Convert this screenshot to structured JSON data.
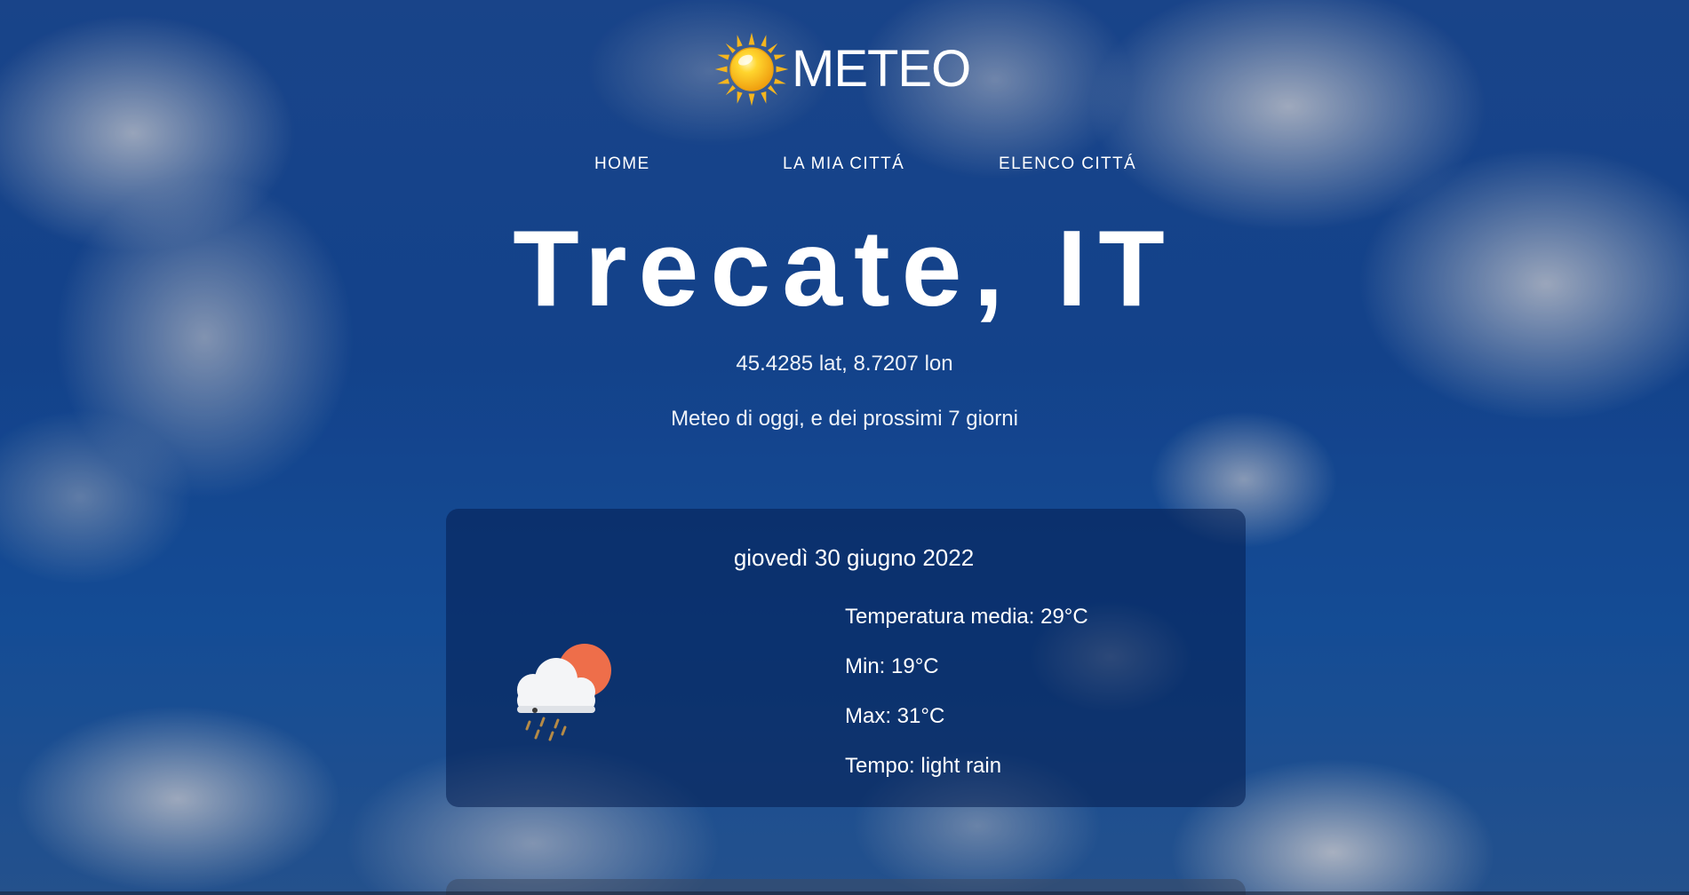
{
  "header": {
    "logo_text": "METEO",
    "logo_icon": "sun-icon"
  },
  "nav": {
    "items": [
      {
        "label": "HOME"
      },
      {
        "label": "LA MIA CITTÁ"
      },
      {
        "label": "ELENCO CITTÁ"
      }
    ]
  },
  "location": {
    "title": "Trecate, IT",
    "coords": "45.4285 lat, 8.7207 lon",
    "subtitle": "Meteo di oggi, e dei prossimi 7 giorni"
  },
  "forecast": [
    {
      "date": "giovedì 30 giugno 2022",
      "icon": "cloud-sun-rain-icon",
      "temperature": "Temperatura media: 29°C",
      "min": "Min: 19°C",
      "max": "Max: 31°C",
      "tempo": "Tempo: light rain"
    }
  ],
  "colors": {
    "sky": "#1d4d9a",
    "card": "#041e50",
    "sun": "#f5b51e",
    "sun_small": "#ee6e4a",
    "cloud": "#f4f5f7",
    "rain": "#b58a46"
  }
}
